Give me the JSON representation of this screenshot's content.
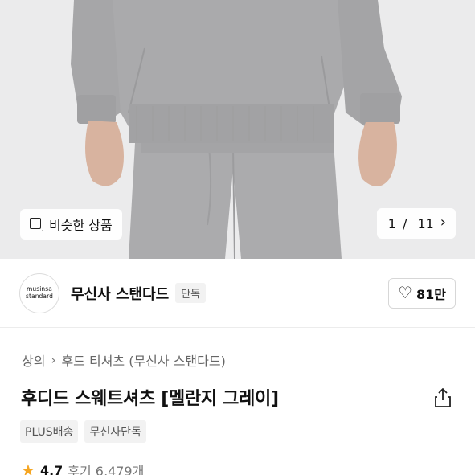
{
  "hero": {
    "similar_label": "비슷한 상품",
    "pager_current": "1",
    "pager_separator": " / ",
    "pager_total": "11",
    "pager_next_icon": "chevron-right-icon",
    "similar_icon": "duplicate-icon",
    "colors": {
      "background": "#ebebec",
      "sweat": "#a9a9ab",
      "skin": "#d9b5a0"
    }
  },
  "brand": {
    "logo_line1": "musinsa",
    "logo_line2": "standard",
    "name": "무신사 스탠다드",
    "tag": "단독",
    "like_icon": "heart-outline-icon",
    "like_count": "81만"
  },
  "breadcrumb": {
    "items": [
      "상의",
      "후드 티셔츠 (무신사 스탠다드)"
    ],
    "separator_icon": "chevron-right-icon"
  },
  "product": {
    "title": "후디드 스웨트셔츠 [멜란지 그레이]",
    "share_icon": "share-icon",
    "chips": [
      "PLUS배송",
      "무신사단독"
    ],
    "rating_icon": "star-icon",
    "rating": "4.7",
    "reviews": "후기 6,479개"
  }
}
